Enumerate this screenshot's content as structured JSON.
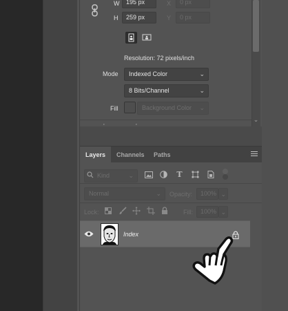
{
  "properties": {
    "width_label": "W",
    "width_value": "195 px",
    "height_label": "H",
    "height_value": "259 px",
    "x_label": "X",
    "x_value": "0 px",
    "y_label": "Y",
    "y_value": "0 px",
    "resolution": "Resolution: 72 pixels/inch",
    "mode_label": "Mode",
    "mode_value": "Indexed Color",
    "depth_value": "8 Bits/Channel",
    "fill_label": "Fill",
    "fill_value": "Background Color"
  },
  "layers_panel": {
    "tabs": [
      {
        "label": "Layers",
        "active": true
      },
      {
        "label": "Channels",
        "active": false
      },
      {
        "label": "Paths",
        "active": false
      }
    ],
    "filter_label": "Kind",
    "blend_mode": "Normal",
    "opacity_label": "Opacity:",
    "opacity_value": "100%",
    "lock_label": "Lock:",
    "fill_label": "Fill:",
    "fill_value": "100%",
    "layers": [
      {
        "name": "Index",
        "visible": true,
        "locked": true
      }
    ]
  },
  "colors": {
    "panel_bg": "#535353",
    "selected_layer": "#6a6a6a",
    "field_bg": "#454545",
    "app_dark": "#282828"
  },
  "icons": [
    "link-icon",
    "portrait-icon",
    "landscape-icon",
    "search-icon",
    "image-filter-icon",
    "adjustment-filter-icon",
    "type-filter-icon",
    "shape-filter-icon",
    "smart-object-filter-icon",
    "filter-toggle-icon",
    "lock-transparent-icon",
    "lock-brush-icon",
    "lock-move-icon",
    "lock-artboard-icon",
    "lock-all-icon",
    "eye-icon",
    "lock-icon",
    "hand-pointer-icon",
    "panel-menu-icon"
  ]
}
